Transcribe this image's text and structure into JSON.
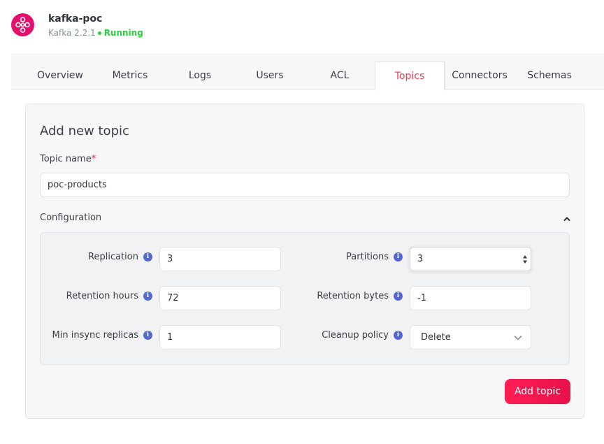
{
  "app": {
    "name": "kafka-poc",
    "version": "Kafka 2.2.1",
    "status": "Running",
    "status_color": "#2ecc40",
    "logo_icon": "kafka-logo-icon",
    "brand_color": "#e3116c"
  },
  "tabs": [
    {
      "label": "Overview",
      "active": false
    },
    {
      "label": "Metrics",
      "active": false
    },
    {
      "label": "Logs",
      "active": false
    },
    {
      "label": "Users",
      "active": false
    },
    {
      "label": "ACL",
      "active": false
    },
    {
      "label": "Topics",
      "active": true
    },
    {
      "label": "Connectors",
      "active": false
    },
    {
      "label": "Schemas",
      "active": false
    }
  ],
  "form": {
    "title": "Add new topic",
    "topic_name_label": "Topic name",
    "required_marker": "*",
    "topic_name_value": "poc-products",
    "configuration_label": "Configuration",
    "fields": {
      "replication": {
        "label": "Replication",
        "value": "3"
      },
      "partitions": {
        "label": "Partitions",
        "value": "3"
      },
      "retention_hours": {
        "label": "Retention hours",
        "value": "72"
      },
      "retention_bytes": {
        "label": "Retention bytes",
        "value": "-1"
      },
      "min_insync_replicas": {
        "label": "Min insync replicas",
        "value": "1"
      },
      "cleanup_policy": {
        "label": "Cleanup policy",
        "value": "Delete"
      }
    },
    "info_glyph": "i",
    "submit_label": "Add topic",
    "accent_color": "#ef3d52"
  }
}
